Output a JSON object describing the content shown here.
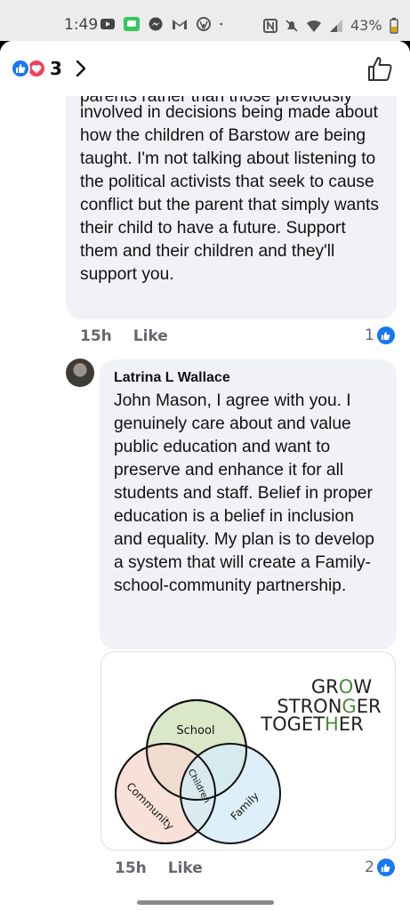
{
  "status": {
    "time": "1:49",
    "battery": "43%"
  },
  "header": {
    "reaction_count": "3"
  },
  "comment1": {
    "cut_line": "parents rather than those previously",
    "text": "involved in decisions being made about how the children of Barstow are being taught. I'm not talking about listening to the political activists that seek to cause conflict but the parent that simply wants their child to have a future. Support them and their children and they'll support you.",
    "time": "15h",
    "like_label": "Like",
    "like_count": "1"
  },
  "comment2": {
    "author": "Latrina L Wallace",
    "text": "John Mason, I agree with you. I genuinely care about and value public education and want to preserve and enhance it for all students and staff. Belief in proper education is a belief in inclusion and equality. My plan is to develop a system that will create a Family-school-community partnership.",
    "time": "15h",
    "like_label": "Like",
    "like_count": "2"
  },
  "image": {
    "headline": [
      "GROW",
      "STRONGER",
      "TOGETHER"
    ],
    "circles": {
      "school": "School",
      "community": "Community",
      "family": "Family",
      "center": "Children"
    }
  },
  "colors": {
    "fb_blue": "#1877f2",
    "love_red": "#f33e58",
    "school_fill": "#d6e4c2",
    "community_fill": "#f5d9cf",
    "family_fill": "#d4ecf8",
    "headline_green": "#4a8a3a"
  }
}
